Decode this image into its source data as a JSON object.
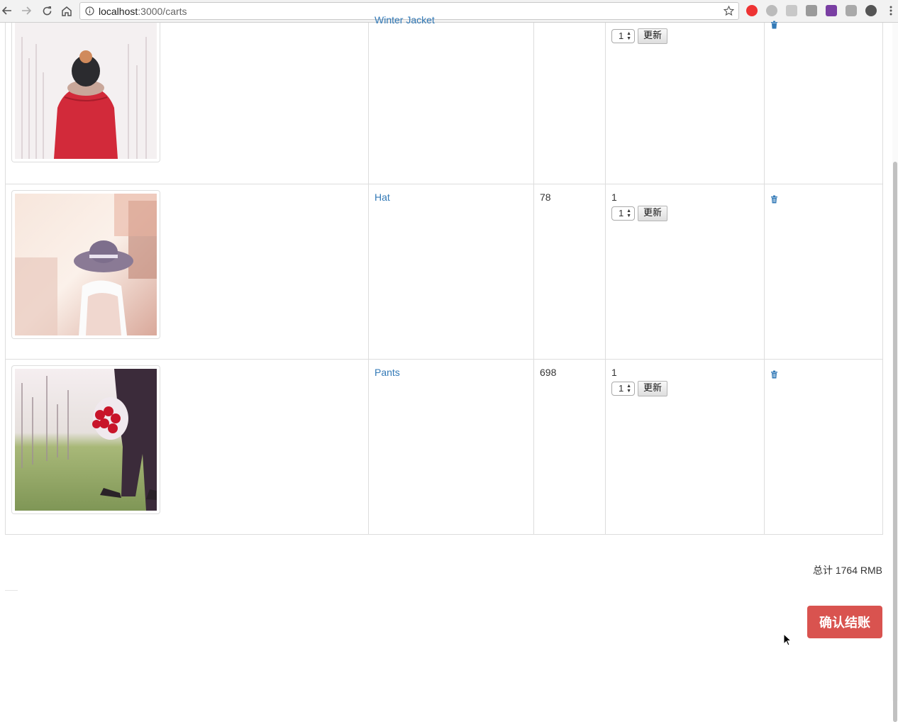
{
  "browser": {
    "url_host": "localhost",
    "url_path": ":3000/carts"
  },
  "cart": {
    "items": [
      {
        "name": "Winter Jacket",
        "price": "",
        "quantity": "",
        "select_value": "1",
        "update_label": "更新",
        "image": "woman-red-jacket"
      },
      {
        "name": "Hat",
        "price": "78",
        "quantity": "1",
        "select_value": "1",
        "update_label": "更新",
        "image": "woman-sun-hat"
      },
      {
        "name": "Pants",
        "price": "698",
        "quantity": "1",
        "select_value": "1",
        "update_label": "更新",
        "image": "man-with-roses"
      }
    ],
    "total_text": "总计 1764 RMB",
    "checkout_label": "确认结账"
  },
  "icons": [
    "back-icon",
    "forward-icon",
    "reload-icon",
    "home-icon",
    "info-icon",
    "star-icon",
    "trash-icon",
    "menu-icon"
  ],
  "colors": {
    "link": "#337ab7",
    "checkout": "#d9534f"
  }
}
